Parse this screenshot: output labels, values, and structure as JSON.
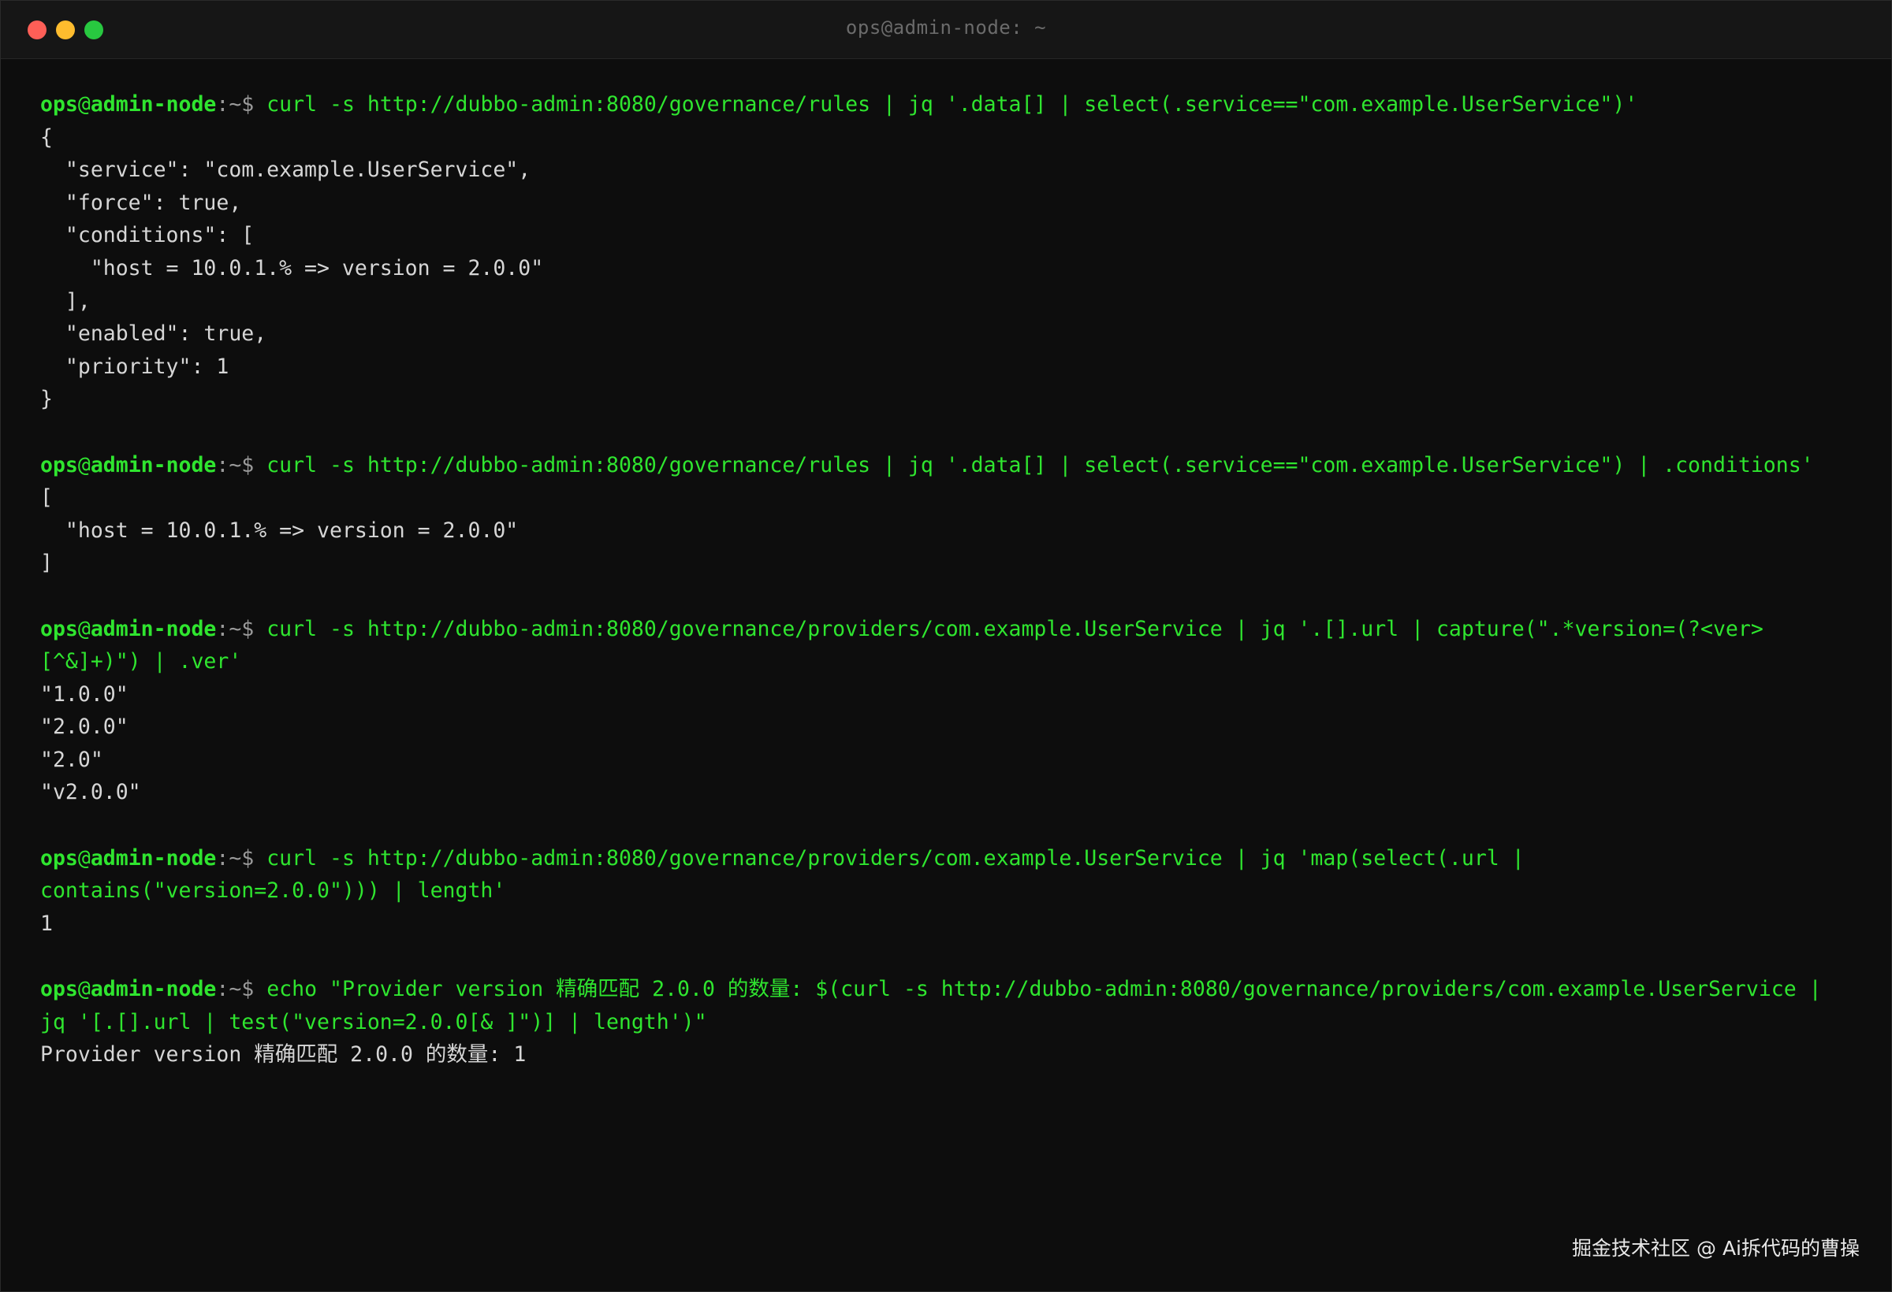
{
  "window": {
    "title": "ops@admin-node: ~"
  },
  "prompt": {
    "user": "ops",
    "at": "@",
    "host": "admin-node",
    "path": ":~$ "
  },
  "blocks": [
    {
      "command_lines": [
        "curl -s http://dubbo-admin:8080/governance/rules | jq '.data[] | select(.service==\"com.example.UserService\")'"
      ],
      "output_lines": [
        "{",
        "  \"service\": \"com.example.UserService\",",
        "  \"force\": true,",
        "  \"conditions\": [",
        "    \"host = 10.0.1.% => version = 2.0.0\"",
        "  ],",
        "  \"enabled\": true,",
        "  \"priority\": 1",
        "}"
      ]
    },
    {
      "command_lines": [
        "curl -s http://dubbo-admin:8080/governance/rules | jq '.data[] | select(.service==\"com.example.UserService\") | .conditions'"
      ],
      "output_lines": [
        "[",
        "  \"host = 10.0.1.% => version = 2.0.0\"",
        "]"
      ]
    },
    {
      "command_lines": [
        "curl -s http://dubbo-admin:8080/governance/providers/com.example.UserService | jq '.[].url | capture(\".*version=(?<ver>",
        "[^&]+)\") | .ver'"
      ],
      "output_lines": [
        "\"1.0.0\"",
        "\"2.0.0\"",
        "\"2.0\"",
        "\"v2.0.0\""
      ]
    },
    {
      "command_lines": [
        "curl -s http://dubbo-admin:8080/governance/providers/com.example.UserService | jq 'map(select(.url |",
        "contains(\"version=2.0.0\"))) | length'"
      ],
      "output_lines": [
        "1"
      ]
    },
    {
      "command_lines": [
        "echo \"Provider version 精确匹配 2.0.0 的数量: $(curl -s http://dubbo-admin:8080/governance/providers/com.example.UserService |",
        "jq '[.[].url | test(\"version=2.0.0[& ]\")] | length')\""
      ],
      "output_lines": [
        "Provider version 精确匹配 2.0.0 的数量: 1"
      ]
    }
  ],
  "watermark": "掘金技术社区 @ Ai拆代码的曹操",
  "colors": {
    "background": "#0d0d0d",
    "titlebar": "#161616",
    "command": "#2fe52f",
    "output": "#d6d6d6",
    "prompt_path": "#9a9a9a"
  }
}
